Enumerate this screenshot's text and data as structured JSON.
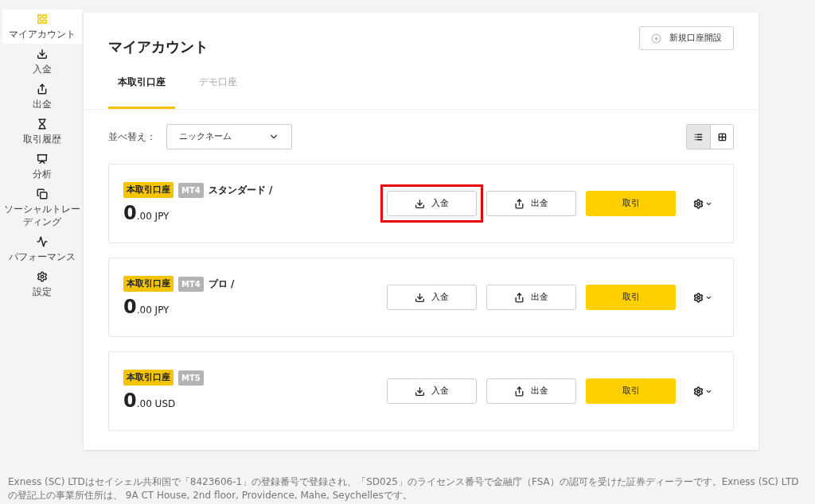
{
  "sidebar": {
    "items": [
      {
        "label": "マイアカウント",
        "selected": true
      },
      {
        "label": "入金",
        "selected": false
      },
      {
        "label": "出金",
        "selected": false
      },
      {
        "label": "取引履歴",
        "selected": false
      },
      {
        "label": "分析",
        "selected": false
      },
      {
        "label": "ソーシャルトレーディング",
        "selected": false
      },
      {
        "label": "パフォーマンス",
        "selected": false
      },
      {
        "label": "設定",
        "selected": false
      }
    ]
  },
  "page": {
    "title": "マイアカウント",
    "new_account_button": "新規口座開設",
    "tabs": [
      {
        "label": "本取引口座",
        "selected": true
      },
      {
        "label": "デモ口座",
        "selected": false
      }
    ],
    "sort": {
      "label": "並べ替え：",
      "value": "ニックネーム"
    },
    "view_toggle": [
      {
        "kind": "list",
        "selected": true
      },
      {
        "kind": "grid",
        "selected": false
      }
    ],
    "accounts": [
      {
        "type_badge": "本取引口座",
        "platform_badge": "MT4",
        "name": "スタンダード /",
        "balance_int": "0",
        "balance_dec": ".00 JPY",
        "deposit": "入金",
        "withdraw": "出金",
        "trade": "取引",
        "highlighted": true
      },
      {
        "type_badge": "本取引口座",
        "platform_badge": "MT4",
        "name": "プロ /",
        "balance_int": "0",
        "balance_dec": ".00 JPY",
        "deposit": "入金",
        "withdraw": "出金",
        "trade": "取引",
        "highlighted": false
      },
      {
        "type_badge": "本取引口座",
        "platform_badge": "MT5",
        "balance_int": "0",
        "balance_dec": ".00 USD",
        "deposit": "入金",
        "withdraw": "出金",
        "trade": "取引",
        "highlighted": false
      }
    ]
  },
  "footer": "Exness (SC) LTDはセイシェル共和国で「8423606-1」の登録番号で登録され、「SD025」のライセンス番号で金融庁（FSA）の認可を受けた証券ディーラーです。Exness (SC) LTDの登記上の事業所住所は、 9A CT House, 2nd floor, Providence, Mahe, Seychellesです。"
}
